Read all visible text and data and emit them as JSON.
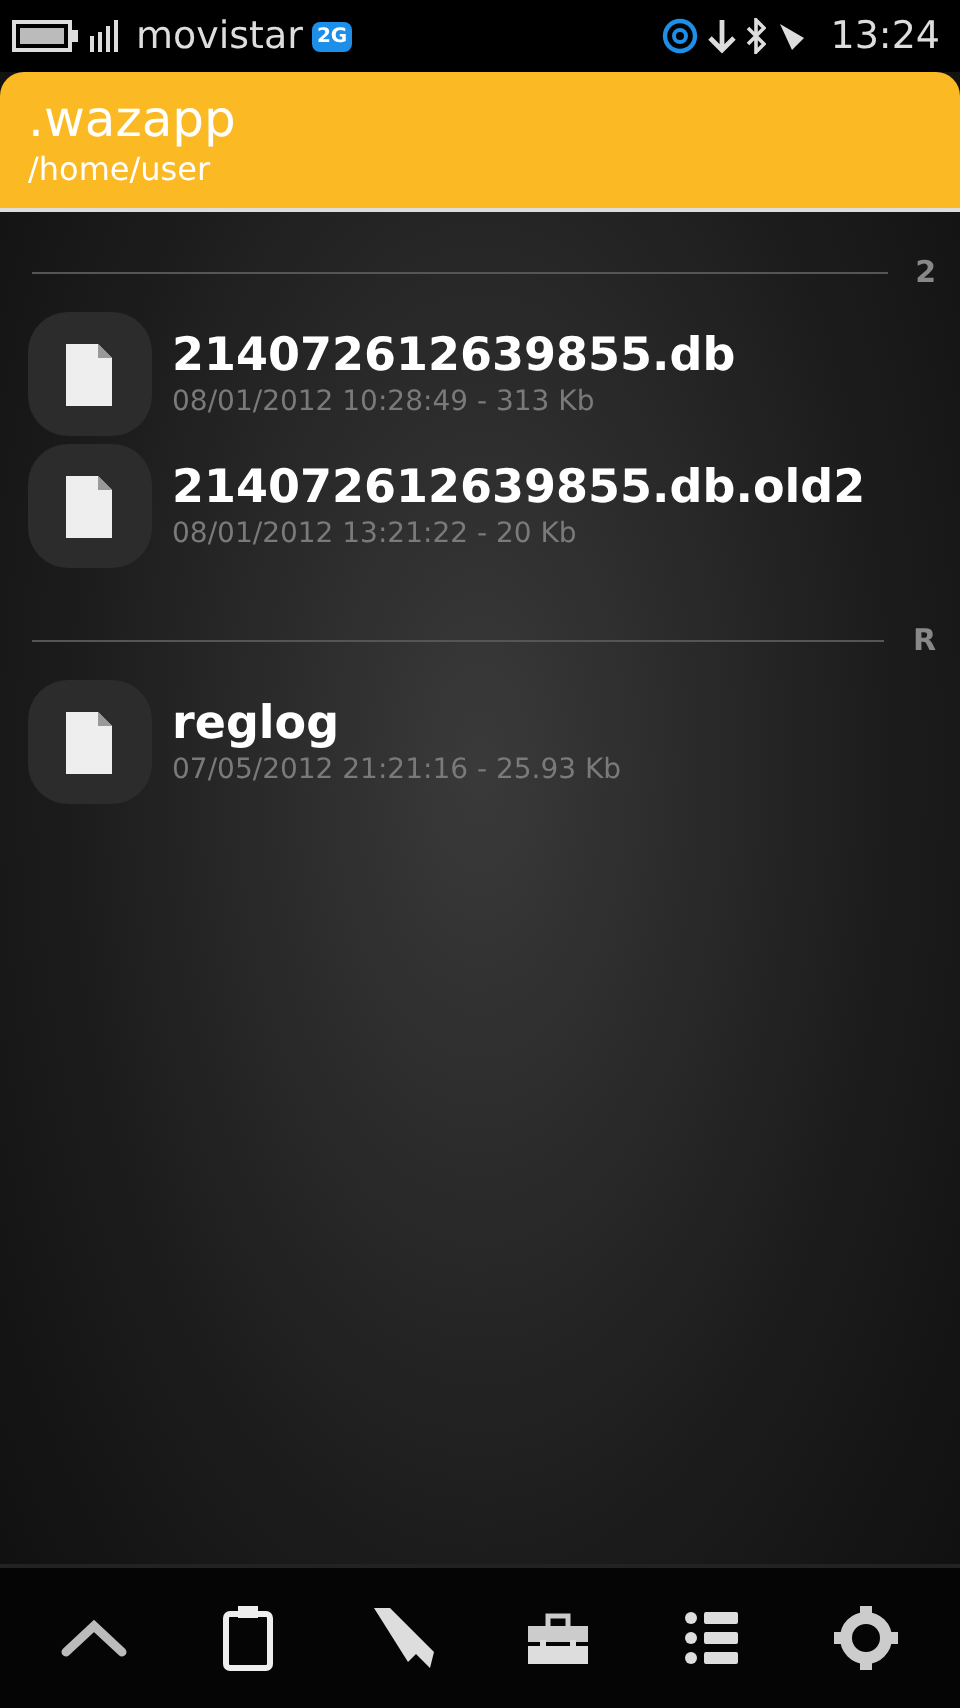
{
  "status_bar": {
    "carrier": "movistar",
    "network_badge": "2G",
    "time": "13:24"
  },
  "header": {
    "title": ".wazapp",
    "path": "/home/user"
  },
  "sections": [
    {
      "letter": "2",
      "files": [
        {
          "name": "214072612639855.db",
          "meta": "08/01/2012 10:28:49 - 313 Kb"
        },
        {
          "name": "214072612639855.db.old2",
          "meta": "08/01/2012 13:21:22 - 20 Kb"
        }
      ]
    },
    {
      "letter": "R",
      "files": [
        {
          "name": "reglog",
          "meta": "07/05/2012 21:21:16 - 25.93 Kb"
        }
      ]
    }
  ],
  "toolbar": [
    {
      "kind": "up"
    },
    {
      "kind": "clipboard"
    },
    {
      "kind": "tag"
    },
    {
      "kind": "toolbox"
    },
    {
      "kind": "list"
    },
    {
      "kind": "settings"
    }
  ]
}
